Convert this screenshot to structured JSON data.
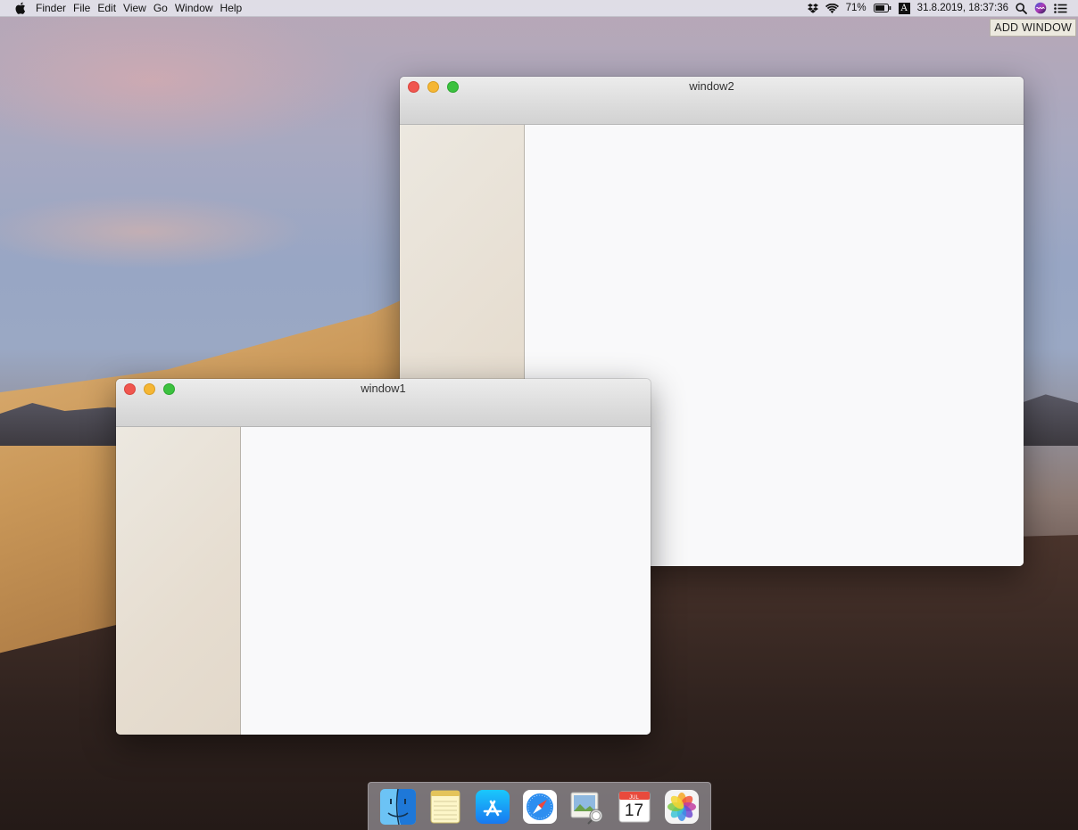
{
  "menubar": {
    "app_name": "Finder",
    "menus": [
      "File",
      "Edit",
      "View",
      "Go",
      "Window",
      "Help"
    ],
    "status": {
      "battery_percent": "71%",
      "input_source": "A",
      "datetime": "31.8.2019, 18:37:36"
    },
    "icons": [
      "apple-icon",
      "dropbox-icon",
      "wifi-icon",
      "battery-icon",
      "input-source-icon",
      "spotlight-icon",
      "siri-icon",
      "notification-center-icon"
    ]
  },
  "add_window_button": {
    "label": "ADD WINDOW"
  },
  "windows": [
    {
      "title": "window2"
    },
    {
      "title": "window1"
    }
  ],
  "dock": {
    "apps": [
      "Finder",
      "Notes",
      "App Store",
      "Safari",
      "Preview",
      "Calendar",
      "Photos"
    ],
    "calendar": {
      "month": "JUL",
      "day": "17"
    }
  },
  "colors": {
    "close": "#f0564f",
    "minimize": "#f5b634",
    "maximize": "#3cc13f"
  }
}
